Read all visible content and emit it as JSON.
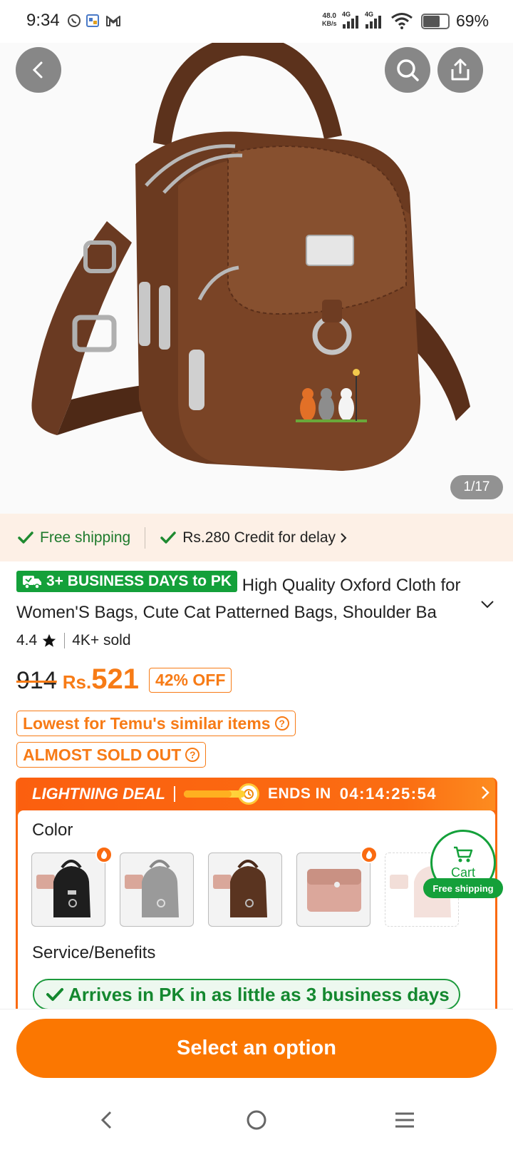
{
  "status_bar": {
    "time": "9:34",
    "net_speed_value": "48.0",
    "net_speed_unit": "KB/s",
    "sim1_label": "4G",
    "sim2_label": "4G",
    "battery": "69%",
    "battery_level": 0.69
  },
  "gallery": {
    "counter": "1/17"
  },
  "shipping": {
    "free_shipping": "Free shipping",
    "credit": "Rs.280 Credit for delay"
  },
  "product": {
    "badge": "3+ BUSINESS DAYS to PK",
    "title": "High Quality Oxford Cloth for Women'S Bags, Cute Cat Patterned Bags, Shoulder Ba",
    "rating": "4.4",
    "sold": "4K+ sold",
    "old_price": "914",
    "currency": "Rs.",
    "price": "521",
    "discount": "42% OFF",
    "tag_lowest": "Lowest for Temu's similar items",
    "tag_sold_out": "ALMOST SOLD OUT",
    "help_symbol": "?"
  },
  "deal": {
    "label": "LIGHTNING DEAL",
    "ends_label": "ENDS IN",
    "timer": "04:14:25:54",
    "progress": 0.78
  },
  "options": {
    "color_label": "Color",
    "service_label": "Service/Benefits",
    "arrive_text": "Arrives in PK in as little as 3 business days"
  },
  "cart": {
    "label": "Cart",
    "ship_label": "Free shipping"
  },
  "cta": {
    "label": "Select an option"
  },
  "colors": {
    "accent_orange": "#fb7701",
    "deal_orange": "#fa6a10",
    "green": "#14a03a"
  }
}
